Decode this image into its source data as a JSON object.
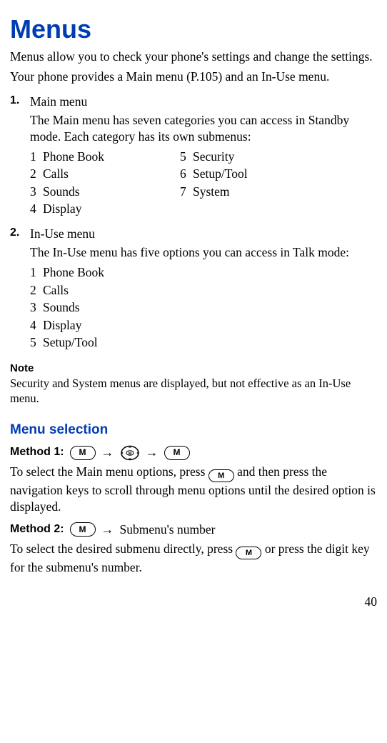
{
  "title": "Menus",
  "intro1": "Menus allow you to check your phone's settings and change the settings.",
  "intro2": "Your phone provides a Main menu (P.105) and an In-Use menu.",
  "step1": {
    "num": "1.",
    "title": "Main menu",
    "desc": "The Main menu has seven categories you can access in Standby mode. Each category has its own submenus:",
    "cats": [
      {
        "n": "1",
        "label": "Phone Book"
      },
      {
        "n": "2",
        "label": "Calls"
      },
      {
        "n": "3",
        "label": "Sounds"
      },
      {
        "n": "4",
        "label": "Display"
      },
      {
        "n": "5",
        "label": "Security"
      },
      {
        "n": "6",
        "label": "Setup/Tool"
      },
      {
        "n": "7",
        "label": "System"
      }
    ]
  },
  "step2": {
    "num": "2.",
    "title": "In-Use menu",
    "desc": "The In-Use menu has five options you can access in Talk mode:",
    "cats": [
      {
        "n": "1",
        "label": "Phone Book"
      },
      {
        "n": "2",
        "label": "Calls"
      },
      {
        "n": "3",
        "label": "Sounds"
      },
      {
        "n": "4",
        "label": "Display"
      },
      {
        "n": "5",
        "label": "Setup/Tool"
      }
    ]
  },
  "note": {
    "head": "Note",
    "body": "Security and System menus are displayed, but not effective as an In-Use menu."
  },
  "section": "Menu selection",
  "method1": {
    "label": "Method 1:",
    "desc1a": "To select the Main menu options, press ",
    "desc1b": " and then press the navigation keys to scroll through menu options until the desired option is displayed."
  },
  "method2": {
    "label": "Method 2:",
    "tail": "Submenu's number",
    "desc2a": "To select the desired submenu directly, press ",
    "desc2b": " or ",
    "desc2c": " press the digit key for the submenu's number."
  },
  "keyM": "M",
  "pageNum": "40"
}
